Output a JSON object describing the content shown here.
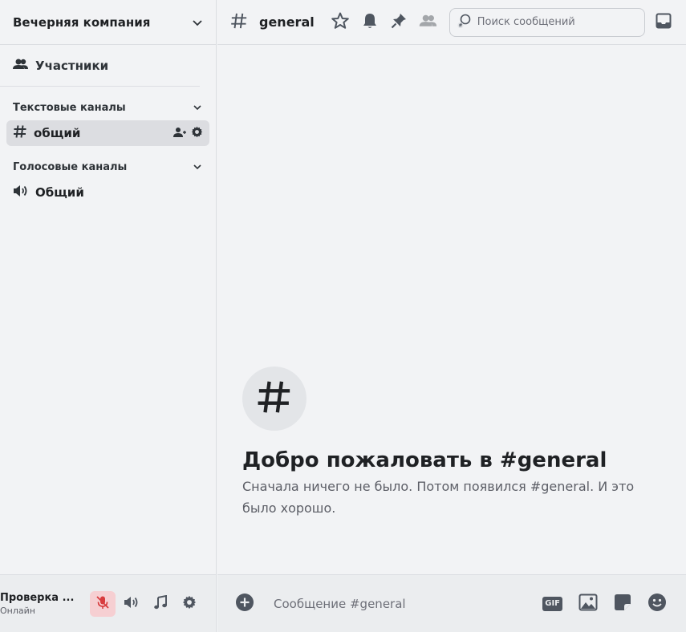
{
  "server": {
    "name": "Вечерняя компания"
  },
  "sidebar": {
    "members_label": "Участники",
    "categories": [
      {
        "label": "Текстовые каналы",
        "channels": [
          {
            "label": "общий",
            "type": "text",
            "active": true
          }
        ]
      },
      {
        "label": "Голосовые каналы",
        "channels": [
          {
            "label": "Общий",
            "type": "voice",
            "active": false
          }
        ]
      }
    ]
  },
  "user": {
    "name": "Проверка ...",
    "status": "Онлайн"
  },
  "topbar": {
    "channel_name": "general",
    "search_placeholder": "Поиск сообщений"
  },
  "welcome": {
    "title": "Добро пожаловать в #general",
    "description": "Сначала ничего не было. Потом появился #general. И это было хорошо."
  },
  "composer": {
    "placeholder": "Сообщение #general",
    "gif_label": "GIF"
  },
  "colors": {
    "muted_bg": "#f6cfd2",
    "muted_icon": "#d83c3e",
    "icon": "#4f5660",
    "active_channel": "#dcdde1"
  }
}
